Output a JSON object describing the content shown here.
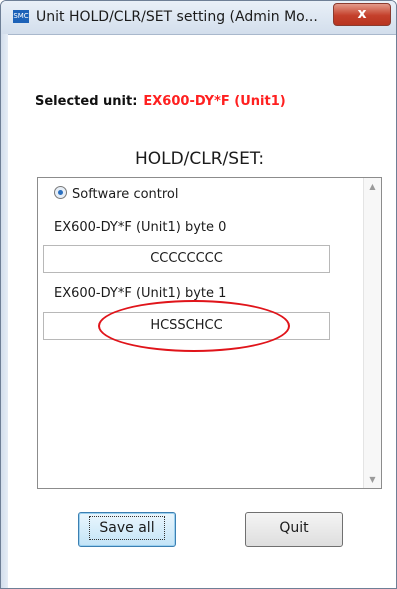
{
  "window": {
    "title": "Unit HOLD/CLR/SET setting (Admin Mo...",
    "app_icon_text": "SMC",
    "close_label": "x"
  },
  "selected_unit": {
    "label": "Selected unit:",
    "value": "EX600-DY*F (Unit1)",
    "value_color": "#ff2020"
  },
  "section_title": "HOLD/CLR/SET:",
  "panel": {
    "radio_label": "Software control",
    "radio_checked": true,
    "bytes": [
      {
        "label": "EX600-DY*F (Unit1)  byte 0",
        "value": "CCCCCCCC"
      },
      {
        "label": "EX600-DY*F (Unit1)  byte 1",
        "value": "HCSSCHCC"
      }
    ]
  },
  "buttons": {
    "save_label": "Save all",
    "quit_label": "Quit"
  },
  "colors": {
    "annotation": "#e0141a",
    "accent": "#3c7fb1"
  }
}
